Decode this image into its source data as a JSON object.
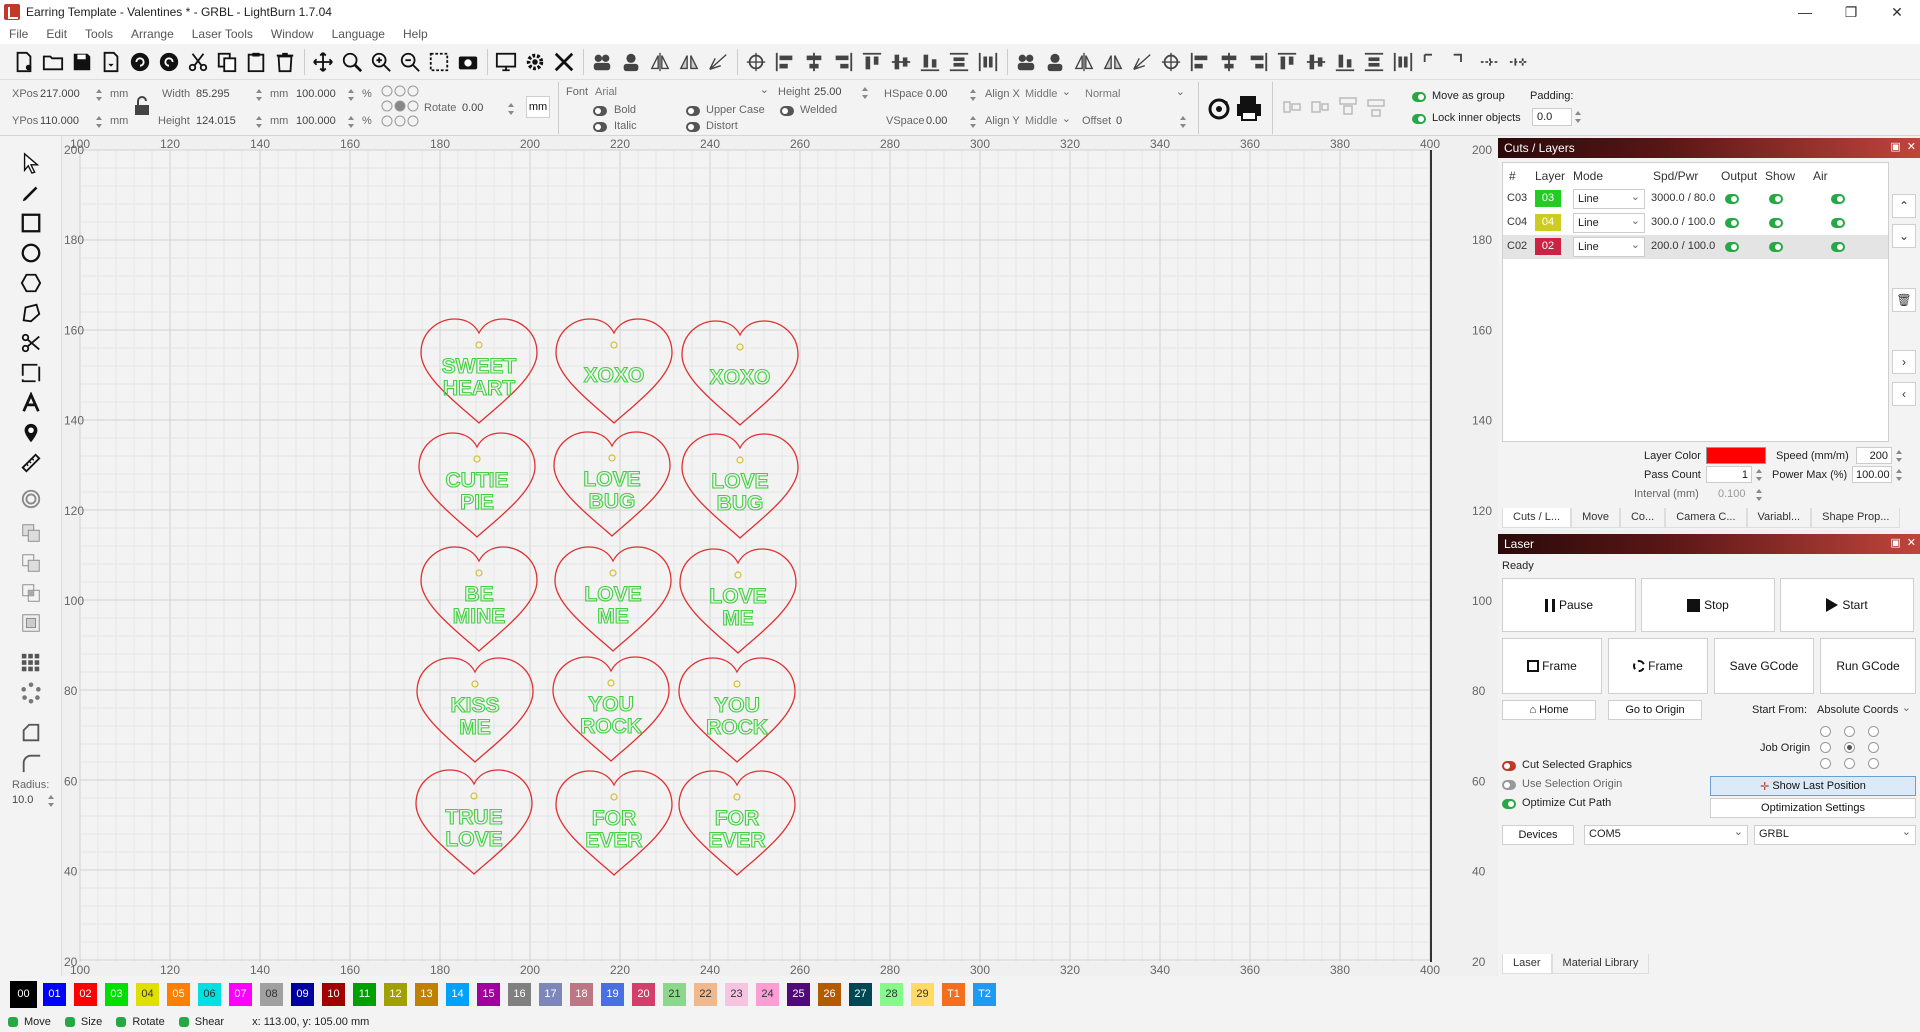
{
  "window": {
    "title": "Earring Template - Valentines * - GRBL - LightBurn 1.7.04",
    "controls": [
      "—",
      "❐",
      "✕"
    ]
  },
  "menu": [
    "File",
    "Edit",
    "Tools",
    "Arrange",
    "Laser Tools",
    "Window",
    "Language",
    "Help"
  ],
  "props": {
    "xpos_label": "XPos",
    "xpos": "217.000",
    "ypos_label": "YPos",
    "ypos": "110.000",
    "unit": "mm",
    "width_label": "Width",
    "width": "85.295",
    "height_label": "Height",
    "height": "124.015",
    "scale_w": "100.000",
    "scale_h": "100.000",
    "pct": "%",
    "rotate_label": "Rotate",
    "rotate": "0.00",
    "mm_btn": "mm",
    "font_label": "Font",
    "font": "Arial",
    "text_height_label": "Height",
    "text_height": "25.00",
    "hspace_label": "HSpace",
    "hspace": "0.00",
    "vspace_label": "VSpace",
    "vspace": "0.00",
    "alignx_label": "Align X",
    "alignx": "Middle",
    "aligny_label": "Align Y",
    "aligny": "Middle",
    "mode": "Normal",
    "offset_label": "Offset",
    "offset": "0",
    "bold": "Bold",
    "italic": "Italic",
    "upper": "Upper Case",
    "distort": "Distort",
    "welded": "Welded",
    "move_group": "Move as group",
    "lock_inner": "Lock inner objects",
    "padding_label": "Padding:",
    "padding": "0.0"
  },
  "left_tools": {
    "radius_label": "Radius:",
    "radius": "10.0"
  },
  "canvas": {
    "x_ticks": [
      "100",
      "120",
      "140",
      "160",
      "180",
      "200",
      "220",
      "240",
      "260",
      "280",
      "300",
      "320",
      "340",
      "360",
      "380",
      "400"
    ],
    "y_ticks": [
      "200",
      "180",
      "160",
      "140",
      "120",
      "100",
      "80",
      "60",
      "40",
      "20"
    ],
    "hearts": [
      [
        "SWEET",
        "HEART"
      ],
      [
        "XOXO",
        ""
      ],
      [
        "XOXO",
        ""
      ],
      [
        "CUTIE",
        "PIE"
      ],
      [
        "LOVE",
        "BUG"
      ],
      [
        "LOVE",
        "BUG"
      ],
      [
        "BE",
        "MINE"
      ],
      [
        "LOVE",
        "ME"
      ],
      [
        "LOVE",
        "ME"
      ],
      [
        "KISS",
        "ME"
      ],
      [
        "YOU",
        "ROCK"
      ],
      [
        "YOU",
        "ROCK"
      ],
      [
        "TRUE",
        "LOVE"
      ],
      [
        "FOR",
        "EVER"
      ],
      [
        "FOR",
        "EVER"
      ]
    ],
    "heart_color": "#e03030",
    "text_color": "#40d040",
    "hole_color": "#d4c030"
  },
  "cuts": {
    "title": "Cuts / Layers",
    "headers": [
      "#",
      "Layer",
      "Mode",
      "Spd/Pwr",
      "Output",
      "Show",
      "Air"
    ],
    "rows": [
      {
        "id": "C03",
        "layer": "03",
        "color": "#22cc22",
        "mode": "Line",
        "spdpwr": "3000.0 / 80.0"
      },
      {
        "id": "C04",
        "layer": "04",
        "color": "#cccc22",
        "mode": "Line",
        "spdpwr": "300.0 / 100.0"
      },
      {
        "id": "C02",
        "layer": "02",
        "color": "#cc2244",
        "mode": "Line",
        "spdpwr": "200.0 / 100.0"
      }
    ],
    "layer_color_label": "Layer Color",
    "speed_label": "Speed (mm/m)",
    "speed": "200",
    "pass_label": "Pass Count",
    "pass": "1",
    "power_label": "Power Max (%)",
    "power": "100.00",
    "interval_label": "Interval (mm)",
    "interval": "0.100",
    "tabs": [
      "Cuts / L...",
      "Move",
      "Co...",
      "Camera C...",
      "Variabl...",
      "Shape Prop..."
    ]
  },
  "laser": {
    "title": "Laser",
    "status": "Ready",
    "pause": "Pause",
    "stop": "Stop",
    "start": "Start",
    "frame1": "Frame",
    "frame2": "Frame",
    "save_gcode": "Save GCode",
    "run_gcode": "Run GCode",
    "home": "Home",
    "goto_origin": "Go to Origin",
    "start_from_label": "Start From:",
    "start_from": "Absolute Coords",
    "job_origin_label": "Job Origin",
    "cut_selected": "Cut Selected Graphics",
    "use_sel_origin": "Use Selection Origin",
    "optimize": "Optimize Cut Path",
    "show_last": "Show Last Position",
    "opt_settings": "Optimization Settings",
    "devices": "Devices",
    "port": "COM5",
    "device": "GRBL",
    "tabs": [
      "Laser",
      "Material Library"
    ]
  },
  "palette": [
    {
      "l": "00",
      "c": "#000000"
    },
    {
      "l": "01",
      "c": "#0000ff"
    },
    {
      "l": "02",
      "c": "#ff0000"
    },
    {
      "l": "03",
      "c": "#00e000"
    },
    {
      "l": "04",
      "c": "#e0e000"
    },
    {
      "l": "05",
      "c": "#ff8000"
    },
    {
      "l": "06",
      "c": "#00e0e0"
    },
    {
      "l": "07",
      "c": "#ff00ff"
    },
    {
      "l": "08",
      "c": "#a0a0a0"
    },
    {
      "l": "09",
      "c": "#0000a0"
    },
    {
      "l": "10",
      "c": "#a00000"
    },
    {
      "l": "11",
      "c": "#00a000"
    },
    {
      "l": "12",
      "c": "#a0a000"
    },
    {
      "l": "13",
      "c": "#c08000"
    },
    {
      "l": "14",
      "c": "#00a0ff"
    },
    {
      "l": "15",
      "c": "#a000a0"
    },
    {
      "l": "16",
      "c": "#808080"
    },
    {
      "l": "17",
      "c": "#7d87b9"
    },
    {
      "l": "18",
      "c": "#bb7784"
    },
    {
      "l": "19",
      "c": "#4a6fe3"
    },
    {
      "l": "20",
      "c": "#d33f6a"
    },
    {
      "l": "21",
      "c": "#8cd78c"
    },
    {
      "l": "22",
      "c": "#f0b98d"
    },
    {
      "l": "23",
      "c": "#f6c4e1"
    },
    {
      "l": "24",
      "c": "#fa9ed4"
    },
    {
      "l": "25",
      "c": "#500a78"
    },
    {
      "l": "26",
      "c": "#b45a00"
    },
    {
      "l": "27",
      "c": "#004754"
    },
    {
      "l": "28",
      "c": "#86fa88"
    },
    {
      "l": "29",
      "c": "#ffdb66"
    },
    {
      "l": "T1",
      "c": "#f36f1e"
    },
    {
      "l": "T2",
      "c": "#1e9af3"
    }
  ],
  "status": {
    "move": "Move",
    "size": "Size",
    "rotate": "Rotate",
    "shear": "Shear",
    "coords": "x: 113.00, y: 105.00 mm"
  }
}
